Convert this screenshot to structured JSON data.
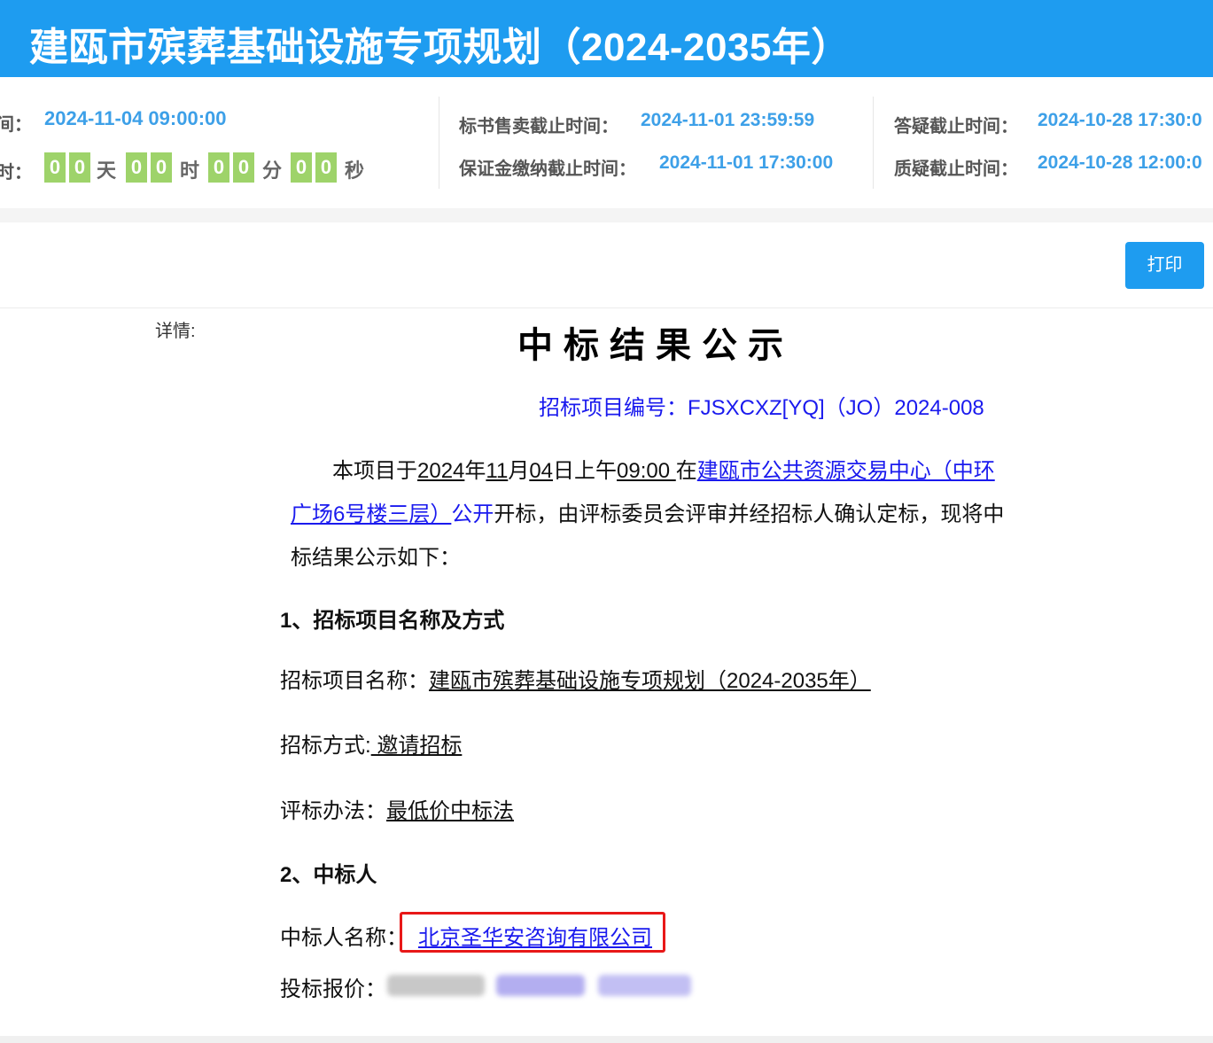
{
  "header": {
    "title": "建瓯市殡葬基础设施专项规划（2024-2035年）"
  },
  "info": {
    "open_time_label": "间：",
    "open_time": "2024-11-04 09:00:00",
    "countdown_label": "时：",
    "countdown": {
      "days": [
        "0",
        "0"
      ],
      "hours": [
        "0",
        "0"
      ],
      "minutes": [
        "0",
        "0"
      ],
      "seconds": [
        "0",
        "0"
      ],
      "unit_day": "天",
      "unit_hour": "时",
      "unit_minute": "分",
      "unit_second": "秒"
    },
    "sale_deadline_label": "标书售卖截止时间：",
    "sale_deadline": "2024-11-01 23:59:59",
    "deposit_deadline_label": "保证金缴纳截止时间：",
    "deposit_deadline": "2024-11-01 17:30:00",
    "qa_deadline_label": "答疑截止时间：",
    "qa_deadline": "2024-10-28 17:30:0",
    "query_deadline_label": "质疑截止时间：",
    "query_deadline": "2024-10-28 12:00:0"
  },
  "toolbar": {
    "print_label": "打印"
  },
  "document": {
    "detail_label": "详情:",
    "title": "中标结果公示",
    "project_no": "招标项目编号：FJSXCXZ[YQ]（JO）2024-008",
    "para1": {
      "prefix": "本项目于",
      "year": "2024",
      "nian": "年",
      "month": "11",
      "yue": "月",
      "day": "04",
      "ri": "日上午",
      "time": "09:00 ",
      "zai": "在",
      "place_line1": "建瓯市公共资源交易中心（中环",
      "place_line2": "广场6号楼三层）",
      "gongkai": "公开",
      "rest_line2": "开标，由评标委员会评审并经招标人确认定标，现将中",
      "line3": "标结果公示如下："
    },
    "section1": "1、招标项目名称及方式",
    "project_name_label": "招标项目名称：",
    "project_name": "建瓯市殡葬基础设施专项规划（2024-2035年）",
    "method_label": "招标方式:",
    "method": " 邀请招标 ",
    "eval_label": "评标办法：",
    "eval": "最低价中标法 ",
    "section2": "2、中标人",
    "winner_label": "中标人名称：",
    "winner": "北京圣华安咨询有限公司  ",
    "bid_price_label": "投标报价："
  },
  "colors": {
    "brand": "#1e9cf0",
    "value_blue": "#3da0e8",
    "countdown_green": "#9ed36a",
    "link_blue": "#1a1aee",
    "highlight_red": "#e81818"
  }
}
